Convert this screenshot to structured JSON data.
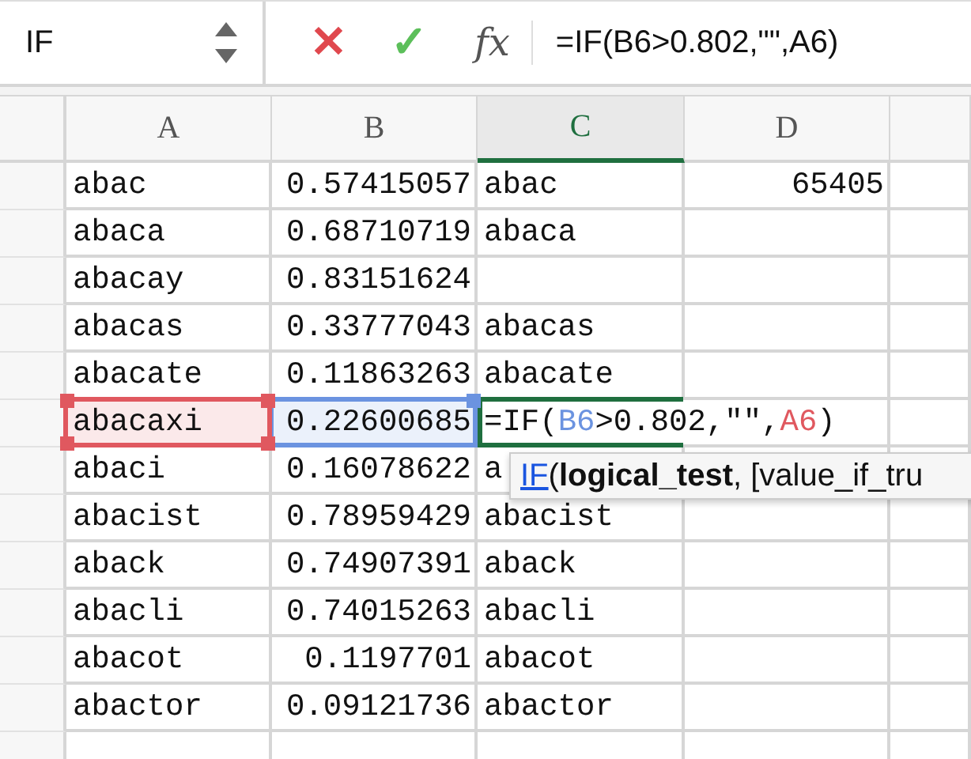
{
  "formula_bar": {
    "name_box": "IF",
    "cancel": "✕",
    "confirm": "✓",
    "fx": "fx",
    "formula": "=IF(B6>0.802,\"\",A6)"
  },
  "columns": [
    {
      "label": "A",
      "selected": false
    },
    {
      "label": "B",
      "selected": false
    },
    {
      "label": "C",
      "selected": true
    },
    {
      "label": "D",
      "selected": false
    }
  ],
  "rows": [
    {
      "cells": [
        {
          "kind": "text",
          "text": "abac"
        },
        {
          "kind": "number",
          "text": "0.57415057"
        },
        {
          "kind": "text",
          "text": "abac"
        },
        {
          "kind": "number",
          "text": "65405"
        }
      ]
    },
    {
      "cells": [
        {
          "kind": "text",
          "text": "abaca"
        },
        {
          "kind": "number",
          "text": "0.68710719"
        },
        {
          "kind": "text",
          "text": "abaca"
        }
      ]
    },
    {
      "cells": [
        {
          "kind": "text",
          "text": "abacay"
        },
        {
          "kind": "number",
          "text": "0.83151624"
        }
      ]
    },
    {
      "cells": [
        {
          "kind": "text",
          "text": "abacas"
        },
        {
          "kind": "number",
          "text": "0.33777043"
        },
        {
          "kind": "text",
          "text": "abacas"
        }
      ]
    },
    {
      "cells": [
        {
          "kind": "text",
          "text": "abacate"
        },
        {
          "kind": "number",
          "text": "0.11863263"
        },
        {
          "kind": "text",
          "text": "abacate"
        }
      ]
    },
    {
      "cells": [
        {
          "kind": "text",
          "text": "abacaxi",
          "color": "#e0585f"
        },
        {
          "kind": "number",
          "text": "0.22600685",
          "color": "#6b93e0"
        },
        {
          "kind": "formula",
          "parts": [
            {
              "text": "=IF("
            },
            {
              "text": "B6",
              "color": "#6b93e0"
            },
            {
              "text": ">0.802,\"\","
            },
            {
              "text": "A6",
              "color": "#e0585f"
            },
            {
              "text": ")"
            }
          ]
        }
      ]
    },
    {
      "cells": [
        {
          "kind": "text",
          "text": "abaci"
        },
        {
          "kind": "number",
          "text": "0.16078622"
        },
        {
          "kind": "text",
          "text": "a"
        }
      ]
    },
    {
      "cells": [
        {
          "kind": "text",
          "text": "abacist"
        },
        {
          "kind": "number",
          "text": "0.78959429"
        },
        {
          "kind": "text",
          "text": "abacist"
        }
      ]
    },
    {
      "cells": [
        {
          "kind": "text",
          "text": "aback"
        },
        {
          "kind": "number",
          "text": "0.74907391"
        },
        {
          "kind": "text",
          "text": "aback"
        }
      ]
    },
    {
      "cells": [
        {
          "kind": "text",
          "text": "abacli"
        },
        {
          "kind": "number",
          "text": "0.74015263"
        },
        {
          "kind": "text",
          "text": "abacli"
        }
      ]
    },
    {
      "cells": [
        {
          "kind": "text",
          "text": "abacot"
        },
        {
          "kind": "number",
          "text": "0.1197701"
        },
        {
          "kind": "text",
          "text": "abacot"
        }
      ]
    },
    {
      "cells": [
        {
          "kind": "text",
          "text": "abactor"
        },
        {
          "kind": "number",
          "text": "0.09121736"
        },
        {
          "kind": "text",
          "text": "abactor"
        }
      ]
    }
  ],
  "tooltip": {
    "function": "IF",
    "args": "(**logical_test**, [value_if_tru"
  }
}
